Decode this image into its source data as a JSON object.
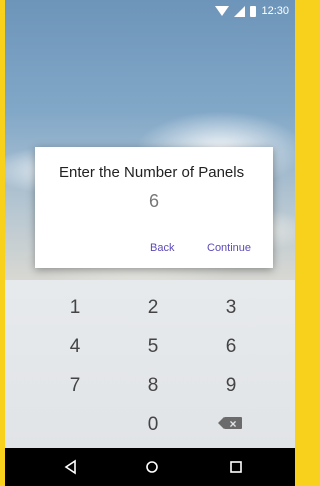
{
  "status_bar": {
    "time": "12:30",
    "icons": [
      "wifi-icon",
      "signal-icon",
      "battery-icon"
    ]
  },
  "dialog": {
    "title": "Enter the Number of Panels",
    "value": "6",
    "back_label": "Back",
    "continue_label": "Continue",
    "button_color": "#5b4bb7"
  },
  "keypad": {
    "rows": [
      [
        "1",
        "2",
        "3"
      ],
      [
        "4",
        "5",
        "6"
      ],
      [
        "7",
        "8",
        "9"
      ],
      [
        "",
        "0",
        "backspace"
      ]
    ]
  },
  "nav_bar": {
    "icons": [
      "back-icon",
      "home-icon",
      "recents-icon"
    ]
  }
}
